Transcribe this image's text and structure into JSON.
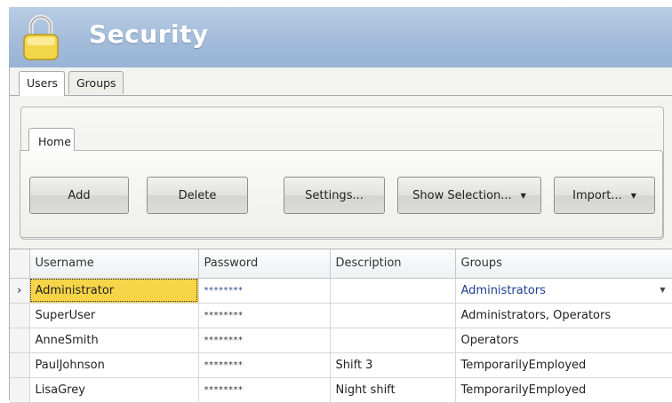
{
  "header": {
    "title": "Security",
    "icon": "lock-icon"
  },
  "tabs": [
    {
      "label": "Users",
      "active": true
    },
    {
      "label": "Groups",
      "active": false
    }
  ],
  "ribbon": {
    "tab": "Home",
    "buttons": {
      "add": "Add",
      "delete": "Delete",
      "settings": "Settings...",
      "show_selection": "Show Selection...",
      "import": "Import..."
    }
  },
  "table": {
    "columns": [
      "Username",
      "Password",
      "Description",
      "Groups"
    ],
    "rows": [
      {
        "username": "Administrator",
        "password": "********",
        "description": "",
        "groups": "Administrators",
        "selected": true
      },
      {
        "username": "SuperUser",
        "password": "********",
        "description": "",
        "groups": "Administrators, Operators"
      },
      {
        "username": "AnneSmith",
        "password": "********",
        "description": "",
        "groups": "Operators"
      },
      {
        "username": "PaulJohnson",
        "password": "********",
        "description": "Shift 3",
        "groups": "TemporarilyEmployed"
      },
      {
        "username": "LisaGrey",
        "password": "********",
        "description": "Night shift",
        "groups": "TemporarilyEmployed"
      }
    ]
  },
  "colors": {
    "header_bg": "#a3bcda",
    "selection": "#f7d448",
    "group_link": "#1e3f8f"
  }
}
